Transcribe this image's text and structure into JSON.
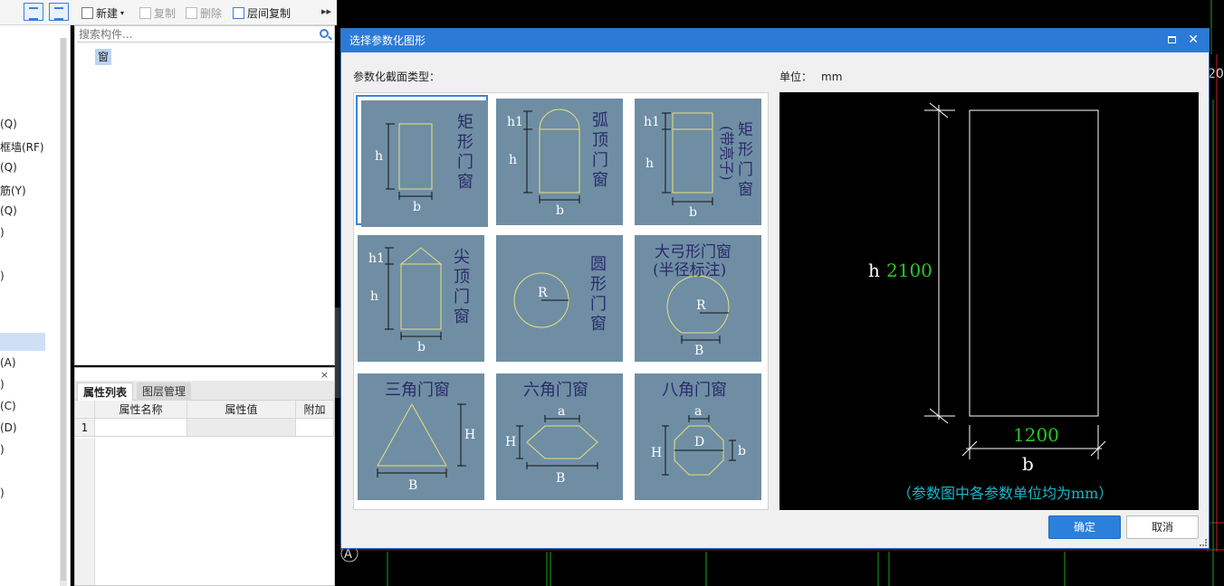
{
  "toolbar": {
    "new_label": "新建",
    "copy_label": "复制",
    "delete_label": "删除",
    "floor_copy_label": "层间复制",
    "more_label": "▸▸"
  },
  "nav": {
    "items": [
      "(Q)",
      "框墙(RF)",
      "(Q)",
      "筋(Y)",
      "(Q)",
      ")",
      ")",
      ")",
      "(A)",
      ")",
      "(C)",
      "(D)",
      ")",
      ")"
    ]
  },
  "tree": {
    "search_placeholder": "搜索构件...",
    "node_label": "窗"
  },
  "props": {
    "tab_attr": "属性列表",
    "tab_layer": "图层管理",
    "close_label": "×",
    "col_name": "属性名称",
    "col_value": "属性值",
    "col_extra": "附加",
    "row1_index": "1"
  },
  "dialog": {
    "title": "选择参数化图形",
    "type_label": "参数化截面类型：",
    "unit_label": "单位：",
    "unit_value": "mm",
    "ok_label": "确定",
    "cancel_label": "取消",
    "close_label": "✕"
  },
  "shapes": [
    {
      "name": "矩形门窗",
      "title_lines": [
        "矩",
        "形",
        "门",
        "窗"
      ],
      "dims": [
        "h",
        "b"
      ]
    },
    {
      "name": "弧顶门窗",
      "title_lines": [
        "弧",
        "顶",
        "门",
        "窗"
      ],
      "dims": [
        "h1",
        "h",
        "b"
      ]
    },
    {
      "name": "矩形门窗(带亮子)",
      "title_lines": [
        "矩",
        "形",
        "门",
        "窗"
      ],
      "side_note": "(带亮子)",
      "dims": [
        "h1",
        "h",
        "b"
      ]
    },
    {
      "name": "尖顶门窗",
      "title_lines": [
        "尖",
        "顶",
        "门",
        "窗"
      ],
      "dims": [
        "h1",
        "h",
        "b"
      ]
    },
    {
      "name": "圆形门窗",
      "title_lines": [
        "圆",
        "形",
        "门",
        "窗"
      ],
      "dims": [
        "R"
      ]
    },
    {
      "name": "大弓形门窗",
      "title_lines": [
        "大弓形门窗",
        "(半径标注)"
      ],
      "dims": [
        "R",
        "B"
      ]
    },
    {
      "name": "三角门窗",
      "title_lines": [
        "三角门窗"
      ],
      "dims": [
        "H",
        "B"
      ]
    },
    {
      "name": "六角门窗",
      "title_lines": [
        "六角门窗"
      ],
      "dims": [
        "a",
        "H",
        "B"
      ]
    },
    {
      "name": "八角门窗",
      "title_lines": [
        "八角门窗"
      ],
      "dims": [
        "a",
        "H",
        "D",
        "b"
      ]
    }
  ],
  "preview": {
    "h_label": "h",
    "h_value": "2100",
    "b_value": "1200",
    "b_label": "b",
    "note": "（参数图中各参数单位均为mm）"
  },
  "cad": {
    "axis_label_a": "A",
    "axis_label_top": "20",
    "axis_label_left": "2"
  },
  "colors": {
    "thumb_bg": "#6f8ea4",
    "shape_line": "#e8e07a",
    "dialog_title": "#2b7ad6",
    "preview_green": "#28c828",
    "preview_cyan": "#19b6c8"
  }
}
